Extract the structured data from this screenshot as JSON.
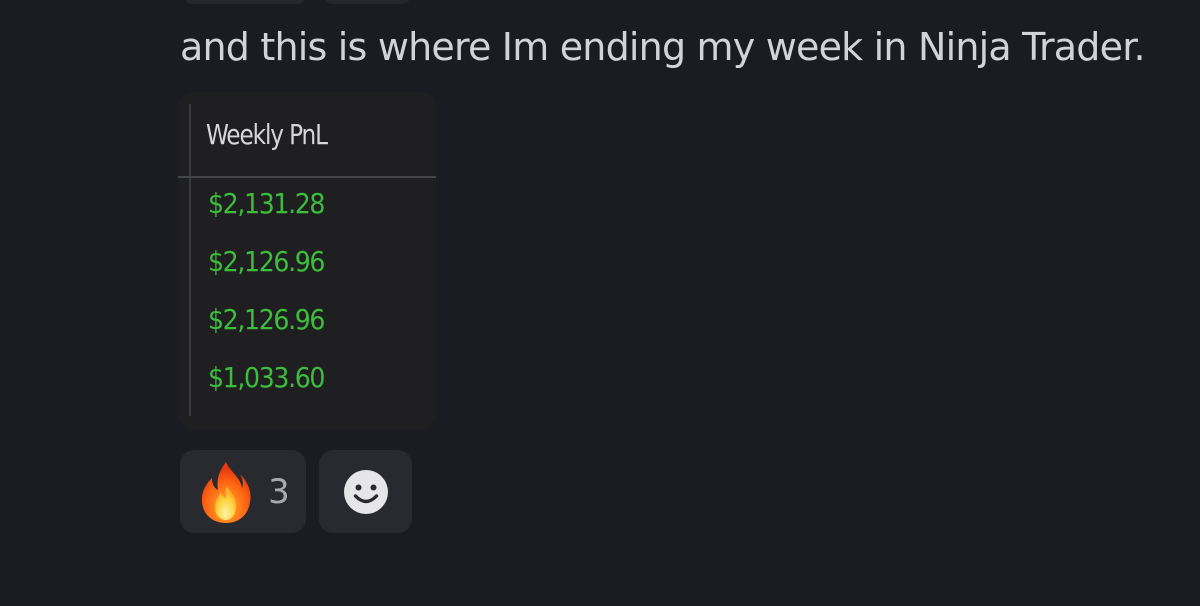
{
  "message": {
    "text": "and this is where Im ending my week in Ninja Trader."
  },
  "attachment": {
    "column_header": "Weekly PnL",
    "rows": [
      "$2,131.28",
      "$2,126.96",
      "$2,126.96",
      "$1,033.60"
    ],
    "value_color": "#3bbf3b"
  },
  "reactions": [
    {
      "emoji": "fire-icon",
      "count": "3"
    },
    {
      "emoji": "add-reaction-smiley-icon"
    }
  ],
  "colors": {
    "background": "#1b1c21",
    "reaction_bg": "#292a30",
    "text": "#d2d3d7"
  }
}
